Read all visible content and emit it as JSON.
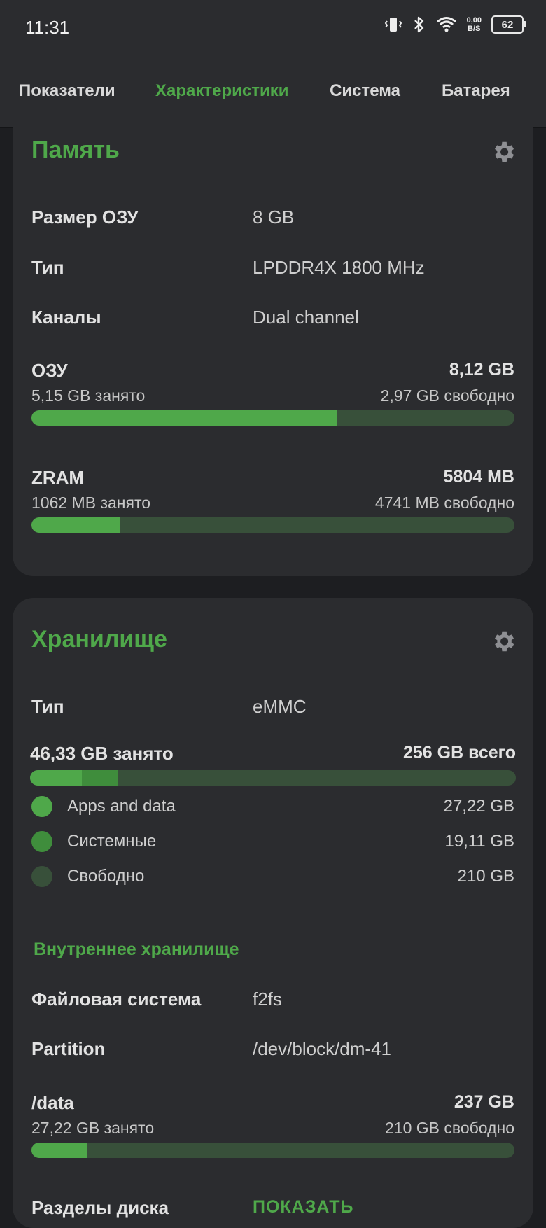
{
  "status_bar": {
    "time": "11:31",
    "net_speed_value": "0,00",
    "net_speed_unit": "B/S",
    "battery": "62",
    "icons": [
      "vibrate-icon",
      "bluetooth-icon",
      "wifi-icon"
    ]
  },
  "tabs": [
    {
      "label": "Показатели",
      "active": false
    },
    {
      "label": "Характеристики",
      "active": true
    },
    {
      "label": "Система",
      "active": false
    },
    {
      "label": "Батарея",
      "active": false
    }
  ],
  "memory": {
    "title": "Память",
    "rows": [
      {
        "label": "Размер ОЗУ",
        "value": "8 GB"
      },
      {
        "label": "Тип",
        "value": "LPDDR4X 1800 MHz"
      },
      {
        "label": "Каналы",
        "value": "Dual channel"
      }
    ],
    "ram": {
      "title": "ОЗУ",
      "total": "8,12 GB",
      "used": "5,15 GB занято",
      "free": "2,97 GB свободно",
      "used_fraction": 0.634
    },
    "zram": {
      "title": "ZRAM",
      "total": "5804 MB",
      "used": "1062 MB занято",
      "free": "4741 MB свободно",
      "used_fraction": 0.183
    }
  },
  "storage": {
    "title": "Хранилище",
    "type_label": "Тип",
    "type_value": "eMMC",
    "used_total_label": "46,33 GB занято",
    "total_label": "256 GB всего",
    "segments_fraction": [
      0.106,
      0.075
    ],
    "legend": [
      {
        "label": "Apps and data",
        "value": "27,22 GB",
        "color": "#4fa84a"
      },
      {
        "label": "Системные",
        "value": "19,11 GB",
        "color": "#3f8d3c"
      },
      {
        "label": "Свободно",
        "value": "210 GB",
        "color": "#38503a"
      }
    ],
    "internal": {
      "subtitle": "Внутреннее хранилище",
      "rows": [
        {
          "label": "Файловая система",
          "value": "f2fs"
        },
        {
          "label": "Partition",
          "value": "/dev/block/dm-41"
        }
      ],
      "data_bar": {
        "title": "/data",
        "total": "237 GB",
        "used": "27,22 GB занято",
        "free": "210 GB свободно",
        "used_fraction": 0.115
      },
      "partitions_label": "Разделы диска",
      "show_button": "ПОКАЗАТЬ"
    }
  },
  "colors": {
    "accent": "#4fa84a",
    "card": "#2b2c2f",
    "background": "#1d1e21",
    "track": "#38503a"
  }
}
